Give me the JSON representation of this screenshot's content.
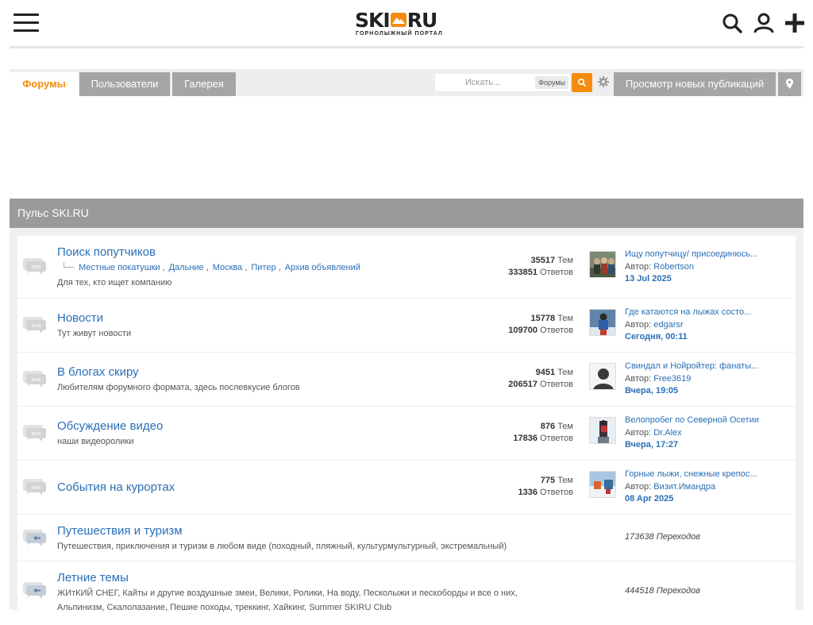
{
  "header": {
    "logo_text_left": "SKI",
    "logo_text_right": "RU",
    "logo_tagline": "ГОРНОЛЫЖНЫЙ ПОРТАЛ",
    "accent": "#f58c0f"
  },
  "nav": {
    "tabs": [
      {
        "label": "Форумы",
        "active": true
      },
      {
        "label": "Пользователи",
        "active": false
      },
      {
        "label": "Галерея",
        "active": false
      }
    ],
    "search_placeholder": "Искать...",
    "search_scope": "Форумы",
    "new_posts_label": "Просмотр новых публикаций"
  },
  "section": {
    "title": "Пульс SKI.RU",
    "forums": [
      {
        "title": "Поиск попутчиков",
        "subforums": [
          "Местные покатушки",
          "Дальние",
          "Москва",
          "Питер",
          "Архив объявлений"
        ],
        "description": "Для тех, кто ищет компанию",
        "topics": "35517",
        "topics_label": "Тем",
        "replies": "333851",
        "replies_label": "Ответов",
        "last_title": "Ищу попутчицу/ присоединюсь...",
        "last_author_label": "Автор:",
        "last_author": "Robertson",
        "last_date": "13 Jul 2025",
        "avatar_icon": "group-photo-icon"
      },
      {
        "title": "Новости",
        "description": "Тут живут новости",
        "topics": "15778",
        "topics_label": "Тем",
        "replies": "109700",
        "replies_label": "Ответов",
        "last_title": "Где катаются на лыжах состо...",
        "last_author_label": "Автор:",
        "last_author": "edgarsr",
        "last_date": "Сегодня, 00:11",
        "avatar_icon": "skier-photo-icon"
      },
      {
        "title": "В блогах скиру",
        "description": "Любителям форумного формата, здесь послевкусие блогов",
        "topics": "9451",
        "topics_label": "Тем",
        "replies": "206517",
        "replies_label": "Ответов",
        "last_title": "Свиндал и Нойройтер: фанаты...",
        "last_author_label": "Автор:",
        "last_author": "Free3619",
        "last_date": "Вчера, 19:05",
        "avatar_icon": "default-user-icon"
      },
      {
        "title": "Обсуждение видео",
        "description": "наши видеоролики",
        "topics": "876",
        "topics_label": "Тем",
        "replies": "17836",
        "replies_label": "Ответов",
        "last_title": "Велопробег по Северной Осетии",
        "last_author_label": "Автор:",
        "last_author": "Dr.Alex",
        "last_date": "Вчера, 17:27",
        "avatar_icon": "cyclist-photo-icon"
      },
      {
        "title": "События на курортах",
        "description": "",
        "topics": "775",
        "topics_label": "Тем",
        "replies": "1336",
        "replies_label": "Ответов",
        "last_title": "Горные лыжи, снежные крепос...",
        "last_author_label": "Автор:",
        "last_author": "Визит.Имандра",
        "last_date": "08 Apr 2025",
        "avatar_icon": "snow-photo-icon"
      },
      {
        "title": "Путешествия и туризм",
        "description": "Путешествия, приключения и туризм в любом виде (походный, пляжный, культурмультурный, экстремальный)",
        "redirects": "173638 Переходов"
      },
      {
        "title": "Летние темы",
        "description_line1": "ЖИтКИЙ СНЕГ, Кайты и другие воздушные змеи, Велики, Ролики, На воду, Песколыжи и пескоборды и все о них,",
        "description_line2": "Альпинизм, Скалолазание, Пешие походы, треккинг, Хайкинг, Summer SKIRU Club",
        "redirects": "444518 Переходов"
      }
    ]
  }
}
